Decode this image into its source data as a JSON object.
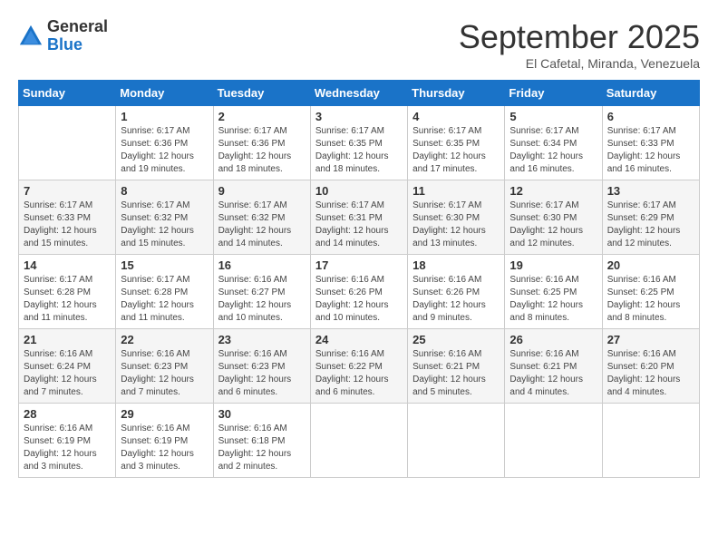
{
  "logo": {
    "general": "General",
    "blue": "Blue"
  },
  "title": "September 2025",
  "location": "El Cafetal, Miranda, Venezuela",
  "days_header": [
    "Sunday",
    "Monday",
    "Tuesday",
    "Wednesday",
    "Thursday",
    "Friday",
    "Saturday"
  ],
  "weeks": [
    [
      {
        "num": "",
        "sunrise": "",
        "sunset": "",
        "daylight": "",
        "empty": true
      },
      {
        "num": "1",
        "sunrise": "Sunrise: 6:17 AM",
        "sunset": "Sunset: 6:36 PM",
        "daylight": "Daylight: 12 hours and 19 minutes."
      },
      {
        "num": "2",
        "sunrise": "Sunrise: 6:17 AM",
        "sunset": "Sunset: 6:36 PM",
        "daylight": "Daylight: 12 hours and 18 minutes."
      },
      {
        "num": "3",
        "sunrise": "Sunrise: 6:17 AM",
        "sunset": "Sunset: 6:35 PM",
        "daylight": "Daylight: 12 hours and 18 minutes."
      },
      {
        "num": "4",
        "sunrise": "Sunrise: 6:17 AM",
        "sunset": "Sunset: 6:35 PM",
        "daylight": "Daylight: 12 hours and 17 minutes."
      },
      {
        "num": "5",
        "sunrise": "Sunrise: 6:17 AM",
        "sunset": "Sunset: 6:34 PM",
        "daylight": "Daylight: 12 hours and 16 minutes."
      },
      {
        "num": "6",
        "sunrise": "Sunrise: 6:17 AM",
        "sunset": "Sunset: 6:33 PM",
        "daylight": "Daylight: 12 hours and 16 minutes."
      }
    ],
    [
      {
        "num": "7",
        "sunrise": "Sunrise: 6:17 AM",
        "sunset": "Sunset: 6:33 PM",
        "daylight": "Daylight: 12 hours and 15 minutes."
      },
      {
        "num": "8",
        "sunrise": "Sunrise: 6:17 AM",
        "sunset": "Sunset: 6:32 PM",
        "daylight": "Daylight: 12 hours and 15 minutes."
      },
      {
        "num": "9",
        "sunrise": "Sunrise: 6:17 AM",
        "sunset": "Sunset: 6:32 PM",
        "daylight": "Daylight: 12 hours and 14 minutes."
      },
      {
        "num": "10",
        "sunrise": "Sunrise: 6:17 AM",
        "sunset": "Sunset: 6:31 PM",
        "daylight": "Daylight: 12 hours and 14 minutes."
      },
      {
        "num": "11",
        "sunrise": "Sunrise: 6:17 AM",
        "sunset": "Sunset: 6:30 PM",
        "daylight": "Daylight: 12 hours and 13 minutes."
      },
      {
        "num": "12",
        "sunrise": "Sunrise: 6:17 AM",
        "sunset": "Sunset: 6:30 PM",
        "daylight": "Daylight: 12 hours and 12 minutes."
      },
      {
        "num": "13",
        "sunrise": "Sunrise: 6:17 AM",
        "sunset": "Sunset: 6:29 PM",
        "daylight": "Daylight: 12 hours and 12 minutes."
      }
    ],
    [
      {
        "num": "14",
        "sunrise": "Sunrise: 6:17 AM",
        "sunset": "Sunset: 6:28 PM",
        "daylight": "Daylight: 12 hours and 11 minutes."
      },
      {
        "num": "15",
        "sunrise": "Sunrise: 6:17 AM",
        "sunset": "Sunset: 6:28 PM",
        "daylight": "Daylight: 12 hours and 11 minutes."
      },
      {
        "num": "16",
        "sunrise": "Sunrise: 6:16 AM",
        "sunset": "Sunset: 6:27 PM",
        "daylight": "Daylight: 12 hours and 10 minutes."
      },
      {
        "num": "17",
        "sunrise": "Sunrise: 6:16 AM",
        "sunset": "Sunset: 6:26 PM",
        "daylight": "Daylight: 12 hours and 10 minutes."
      },
      {
        "num": "18",
        "sunrise": "Sunrise: 6:16 AM",
        "sunset": "Sunset: 6:26 PM",
        "daylight": "Daylight: 12 hours and 9 minutes."
      },
      {
        "num": "19",
        "sunrise": "Sunrise: 6:16 AM",
        "sunset": "Sunset: 6:25 PM",
        "daylight": "Daylight: 12 hours and 8 minutes."
      },
      {
        "num": "20",
        "sunrise": "Sunrise: 6:16 AM",
        "sunset": "Sunset: 6:25 PM",
        "daylight": "Daylight: 12 hours and 8 minutes."
      }
    ],
    [
      {
        "num": "21",
        "sunrise": "Sunrise: 6:16 AM",
        "sunset": "Sunset: 6:24 PM",
        "daylight": "Daylight: 12 hours and 7 minutes."
      },
      {
        "num": "22",
        "sunrise": "Sunrise: 6:16 AM",
        "sunset": "Sunset: 6:23 PM",
        "daylight": "Daylight: 12 hours and 7 minutes."
      },
      {
        "num": "23",
        "sunrise": "Sunrise: 6:16 AM",
        "sunset": "Sunset: 6:23 PM",
        "daylight": "Daylight: 12 hours and 6 minutes."
      },
      {
        "num": "24",
        "sunrise": "Sunrise: 6:16 AM",
        "sunset": "Sunset: 6:22 PM",
        "daylight": "Daylight: 12 hours and 6 minutes."
      },
      {
        "num": "25",
        "sunrise": "Sunrise: 6:16 AM",
        "sunset": "Sunset: 6:21 PM",
        "daylight": "Daylight: 12 hours and 5 minutes."
      },
      {
        "num": "26",
        "sunrise": "Sunrise: 6:16 AM",
        "sunset": "Sunset: 6:21 PM",
        "daylight": "Daylight: 12 hours and 4 minutes."
      },
      {
        "num": "27",
        "sunrise": "Sunrise: 6:16 AM",
        "sunset": "Sunset: 6:20 PM",
        "daylight": "Daylight: 12 hours and 4 minutes."
      }
    ],
    [
      {
        "num": "28",
        "sunrise": "Sunrise: 6:16 AM",
        "sunset": "Sunset: 6:19 PM",
        "daylight": "Daylight: 12 hours and 3 minutes."
      },
      {
        "num": "29",
        "sunrise": "Sunrise: 6:16 AM",
        "sunset": "Sunset: 6:19 PM",
        "daylight": "Daylight: 12 hours and 3 minutes."
      },
      {
        "num": "30",
        "sunrise": "Sunrise: 6:16 AM",
        "sunset": "Sunset: 6:18 PM",
        "daylight": "Daylight: 12 hours and 2 minutes."
      },
      {
        "num": "",
        "sunrise": "",
        "sunset": "",
        "daylight": "",
        "empty": true
      },
      {
        "num": "",
        "sunrise": "",
        "sunset": "",
        "daylight": "",
        "empty": true
      },
      {
        "num": "",
        "sunrise": "",
        "sunset": "",
        "daylight": "",
        "empty": true
      },
      {
        "num": "",
        "sunrise": "",
        "sunset": "",
        "daylight": "",
        "empty": true
      }
    ]
  ]
}
